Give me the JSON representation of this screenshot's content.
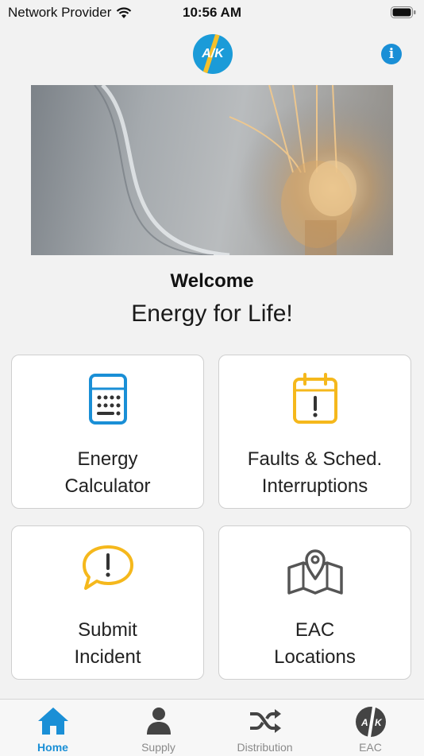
{
  "status_bar": {
    "carrier": "Network Provider",
    "time": "10:56 AM"
  },
  "header": {
    "logo_text": "A/K",
    "info_icon": "info-icon"
  },
  "welcome": {
    "title": "Welcome",
    "tagline": "Energy for Life!"
  },
  "tiles": [
    {
      "line1": "Energy",
      "line2": "Calculator",
      "icon": "calculator-icon",
      "color": "#1a8fd6"
    },
    {
      "line1": "Faults & Sched.",
      "line2": "Interruptions",
      "icon": "calendar-alert-icon",
      "color": "#f5b81c"
    },
    {
      "line1": "Submit",
      "line2": "Incident",
      "icon": "chat-alert-icon",
      "color": "#f5b81c"
    },
    {
      "line1": "EAC",
      "line2": "Locations",
      "icon": "map-pin-icon",
      "color": "#555555"
    }
  ],
  "tabs": [
    {
      "label": "Home",
      "icon": "home-icon",
      "active": true
    },
    {
      "label": "Supply",
      "icon": "person-icon",
      "active": false
    },
    {
      "label": "Distribution",
      "icon": "shuffle-icon",
      "active": false
    },
    {
      "label": "EAC",
      "icon": "eac-logo-icon",
      "active": false
    }
  ],
  "colors": {
    "accent": "#1a8fd6",
    "warning": "#f5b81c",
    "background": "#f2f2f2"
  }
}
